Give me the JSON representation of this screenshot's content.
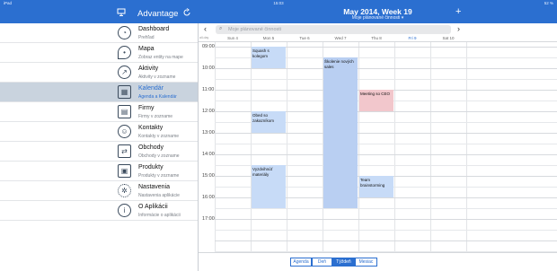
{
  "status_bar": {
    "device": "iPad",
    "time": "15:03",
    "battery": "52 %"
  },
  "header": {
    "app_title": "Advantage",
    "title": "May 2014, Week 19",
    "subtitle": "Moje plánované činnosti ▾",
    "icons": [
      "monitor-icon",
      "refresh-icon",
      "add-icon"
    ]
  },
  "sidebar": {
    "items": [
      {
        "name": "Dashboard",
        "sub": "Prehľad",
        "icon": "dashboard-icon"
      },
      {
        "name": "Mapa",
        "sub": "Zobraz entity na mape",
        "icon": "map-pin-icon"
      },
      {
        "name": "Aktivity",
        "sub": "Aktivity v zozname",
        "icon": "activity-icon"
      },
      {
        "name": "Kalendár",
        "sub": "Agenda a Kalendár",
        "icon": "calendar-icon",
        "active": true
      },
      {
        "name": "Firmy",
        "sub": "Firmy v zozname",
        "icon": "company-icon"
      },
      {
        "name": "Kontakty",
        "sub": "Kontakty v zozname",
        "icon": "contact-icon"
      },
      {
        "name": "Obchody",
        "sub": "Obchody v zozname",
        "icon": "deals-icon"
      },
      {
        "name": "Produkty",
        "sub": "Produkty v zozname",
        "icon": "product-icon"
      },
      {
        "name": "Nastavenia",
        "sub": "Nastavenia aplikácie",
        "icon": "gear-icon"
      },
      {
        "name": "O Aplikácii",
        "sub": "Informácie o aplikácii",
        "icon": "info-icon"
      }
    ]
  },
  "calendar": {
    "search_placeholder": "Moje plánované činnosti",
    "allday_label": "all-day",
    "days": [
      "Sun 4",
      "Mon 5",
      "Tue 6",
      "Wed 7",
      "Thu 8",
      "Fri 9",
      "Sat 10"
    ],
    "today_index": 5,
    "times": [
      "09:00",
      "10:00",
      "11:00",
      "12:00",
      "13:00",
      "14:00",
      "15:00",
      "16:00",
      "17:00"
    ],
    "events": [
      {
        "title": "Squash s kolegom",
        "day": 1,
        "start": "09:00",
        "end": "10:00",
        "color": "#c7dbf7"
      },
      {
        "title": "Školenie nových sales",
        "day": 3,
        "start": "09:30",
        "end": "16:30",
        "color": "#b9cff2"
      },
      {
        "title": "Meeting so CEO",
        "day": 4,
        "start": "11:00",
        "end": "12:00",
        "color": "#f2c7cc"
      },
      {
        "title": "Obed so zakazníkom",
        "day": 1,
        "start": "12:00",
        "end": "13:00",
        "color": "#c7dbf7"
      },
      {
        "title": "Vyzdvihnúť materiály",
        "day": 1,
        "start": "14:30",
        "end": "16:30",
        "color": "#c7dbf7"
      },
      {
        "title": "Team brainstorming",
        "day": 4,
        "start": "15:00",
        "end": "16:00",
        "color": "#c7dbf7"
      }
    ],
    "view_tabs": [
      "Agenda",
      "Deň",
      "Týždeň",
      "Mesiac"
    ],
    "active_tab": "Týždeň"
  }
}
